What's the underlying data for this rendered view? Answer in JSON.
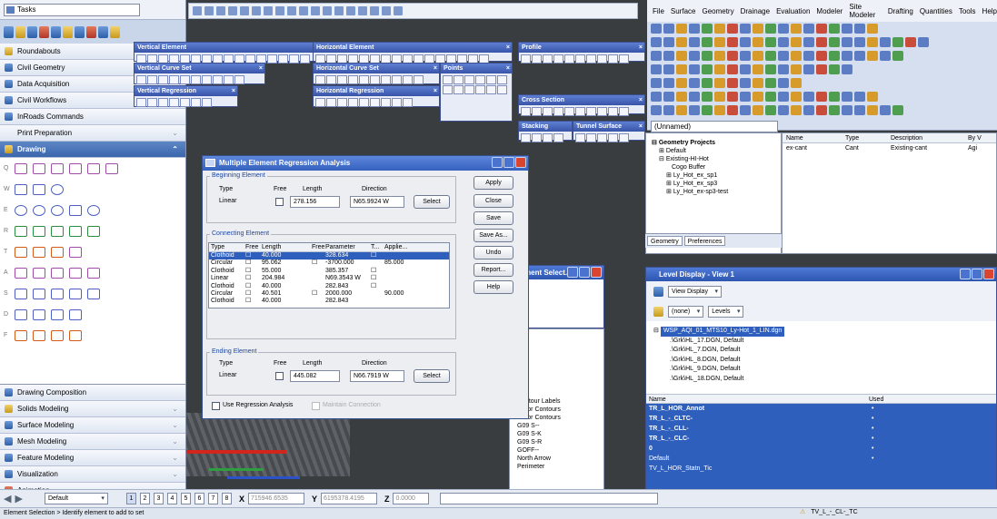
{
  "left_panel": {
    "dropdown": "Tasks",
    "tasks_top": [
      "Roundabouts",
      "Civil Geometry",
      "Data Acquisition",
      "Civil Workflows",
      "InRoads Commands",
      "Print Preparation"
    ],
    "drawing_title": "Drawing",
    "tasks_bottom": [
      "Drawing Composition",
      "Solids Modeling",
      "Surface Modeling",
      "Mesh Modeling",
      "Feature Modeling",
      "Visualization",
      "Animation"
    ],
    "draw_row_letters": [
      "Q",
      "W",
      "E",
      "R",
      "T",
      "A",
      "S",
      "D",
      "F"
    ]
  },
  "palettes": [
    {
      "title": "Vertical Element"
    },
    {
      "title": "Vertical Curve Set"
    },
    {
      "title": "Vertical Regression"
    },
    {
      "title": "Horizontal Element"
    },
    {
      "title": "Horizontal Curve Set"
    },
    {
      "title": "Horizontal Regression"
    },
    {
      "title": "Points"
    },
    {
      "title": "Profile"
    },
    {
      "title": "Cross Section"
    },
    {
      "title": "Stacking"
    },
    {
      "title": "Tunnel Surface"
    }
  ],
  "menubar": [
    "File",
    "Surface",
    "Geometry",
    "Drainage",
    "Evaluation",
    "Modeler",
    "Site Modeler",
    "Drafting",
    "Quantities",
    "Tools",
    "Help"
  ],
  "project": {
    "unnamed": "(Unnamed)",
    "tree": [
      "Geometry Projects",
      "Default",
      "Existing-HI-Hot",
      "Cogo Buffer",
      "Ly_Hot_ex_sp1",
      "Ly_Hot_ex_sp3",
      "Ly_Hot_ex-sp3-test"
    ],
    "tabs": [
      "Geometry",
      "Preferences"
    ],
    "grid_headers": [
      "Name",
      "Type",
      "Description",
      "By V"
    ],
    "grid_row": [
      "ex-cant",
      "Cant",
      "Existing-cant",
      "Agi"
    ]
  },
  "level_display": {
    "title": "Level Display - View 1",
    "view_combo": "View Display",
    "filter_none": "(none)",
    "levels_combo": "Levels",
    "file": "WSP_AQI_01_MTS10_Ly-Hot_1_LIN.dgn",
    "refs": [
      ".\\Grk\\HL_17.DGN, Default",
      ".\\Grk\\HL_7.DGN, Default",
      ".\\Grk\\HL_8.DGN, Default",
      ".\\Grk\\HL_9.DGN, Default",
      ".\\Grk\\HL_18.DGN, Default"
    ],
    "list_headers": [
      "Name",
      "Used"
    ],
    "levels": [
      "TR_L_HOR_Annot",
      "TR_L_-_CLTC-",
      "TR_L_-_CLL-",
      "TR_L_-_CLC-",
      "0",
      "Default",
      "TV_L_HOR_Statn_Tic"
    ]
  },
  "element_select": {
    "title": "Element Select...",
    "list": [
      "Contour Labels",
      "Major Contours",
      "Minor Contours",
      "G09 S--",
      "G09 S-K",
      "G09 S-R",
      "GOFF--",
      "North Arrow",
      "Perimeter"
    ]
  },
  "dialog": {
    "title": "Multiple Element Regression Analysis",
    "beginning_label": "Beginning Element",
    "type_label": "Type",
    "free_label": "Free",
    "length_label": "Length",
    "direction_label": "Direction",
    "begin_type": "Linear",
    "begin_length": "278.156",
    "begin_direction": "N65.9924 W",
    "select": "Select",
    "connecting_label": "Connecting Element",
    "table_headers": [
      "Type",
      "Free",
      "Length",
      "Free",
      "Parameter",
      "T...",
      "Applie..."
    ],
    "table_rows": [
      [
        "Clothoid",
        "",
        "40.000",
        "",
        "328.634",
        "",
        ""
      ],
      [
        "Circular",
        "",
        "95.062",
        "",
        "-3700.000",
        "",
        "85.000"
      ],
      [
        "Clothoid",
        "",
        "55.000",
        "",
        "385.357",
        "",
        ""
      ],
      [
        "Linear",
        "",
        "204.984",
        "",
        "N69.3543 W",
        "",
        ""
      ],
      [
        "Clothoid",
        "",
        "40.000",
        "",
        "282.843",
        "",
        ""
      ],
      [
        "Circular",
        "",
        "40.501",
        "",
        "2000.000",
        "",
        "90.000"
      ],
      [
        "Clothoid",
        "",
        "40.000",
        "",
        "282.843",
        "",
        ""
      ]
    ],
    "ending_label": "Ending Element",
    "end_type": "Linear",
    "end_length": "445.082",
    "end_direction": "N66.7919 W",
    "buttons": [
      "Apply",
      "Close",
      "Save",
      "Save As...",
      "Undo",
      "Report...",
      "Help"
    ],
    "use_regression": "Use Regression Analysis",
    "maintain": "Maintain Connection"
  },
  "bottom": {
    "default_combo": "Default",
    "views": [
      "1",
      "2",
      "3",
      "4",
      "5",
      "6",
      "7",
      "8"
    ],
    "x_label": "X",
    "x_value": "715946.6535",
    "y_label": "Y",
    "y_value": "6195378.4195",
    "z_label": "Z",
    "z_value": "0.0000",
    "status": "Element Selection > Identify element to add to set",
    "status_right": "TV_L_-_CL-_TC"
  },
  "colors": {
    "title_blue": "#3561be",
    "selection": "#2f5fbd",
    "viewport": "#3a3d40"
  }
}
